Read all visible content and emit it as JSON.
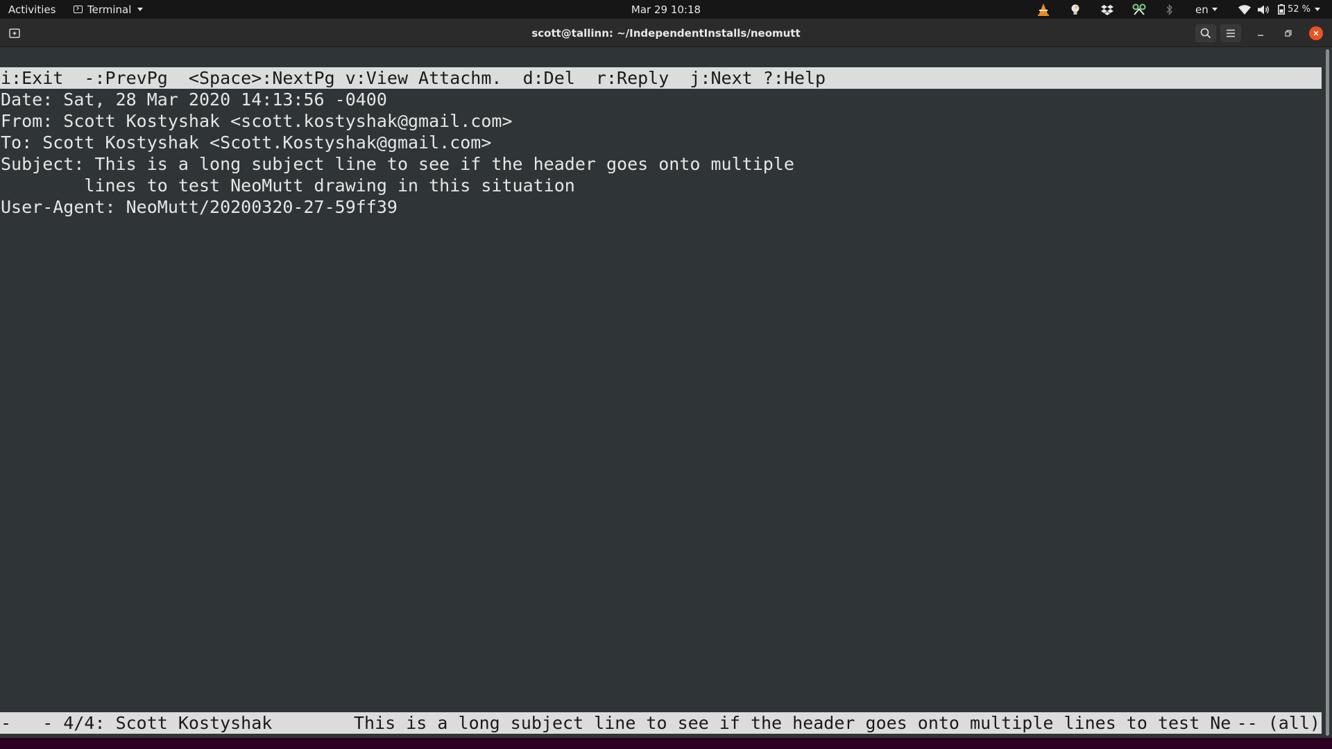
{
  "topbar": {
    "activities": "Activities",
    "app_name": "Terminal",
    "clock": "Mar 29  10:18",
    "language": "en",
    "battery": "52 %"
  },
  "window": {
    "title": "scott@tallinn: ~/IndependentInstalls/neomutt"
  },
  "pager": {
    "help_line": "i:Exit  -:PrevPg  <Space>:NextPg v:View Attachm.  d:Del  r:Reply  j:Next ?:Help",
    "headers": [
      "Date: Sat, 28 Mar 2020 14:13:56 -0400",
      "From: Scott Kostyshak <scott.kostyshak@gmail.com>",
      "To: Scott Kostyshak <Scott.Kostyshak@gmail.com>",
      "Subject: This is a long subject line to see if the header goes onto multiple",
      "        lines to test NeoMutt drawing in this situation",
      "User-Agent: NeoMutt/20200320-27-59ff39"
    ],
    "status": {
      "left": "-   - 4/4: Scott Kostyshak",
      "subject": "This is a long subject line to see if the header goes onto multiple lines to test Ne",
      "right": "-- (all)"
    }
  },
  "colors": {
    "terminal_bg": "#2f3437",
    "bar_bg": "#dcdcdc",
    "accent_close": "#e95420"
  }
}
